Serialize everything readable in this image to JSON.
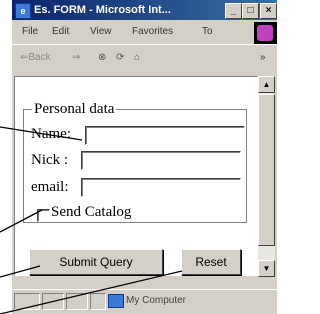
{
  "window": {
    "title": "Es. FORM - Microsoft Int...",
    "minimize": "_",
    "maximize": "□",
    "close": "×",
    "app_icon": "ie-icon"
  },
  "menu": [
    "File",
    "Edit",
    "View",
    "Favorites",
    "To"
  ],
  "toolbar": {
    "back": "⇐Back",
    "forward": "⇒",
    "stop": "⊗",
    "refresh": "⟳",
    "home": "⌂",
    "chevron": "»"
  },
  "form": {
    "legend": "Personal data",
    "name_label": "Name:",
    "nick_label": "Nick :",
    "email_label": "email:",
    "name_value": "",
    "nick_value": "",
    "email_value": "",
    "checkbox_label": "Send Catalog",
    "checkbox_checked": false,
    "submit_label": "Submit Query",
    "reset_label": "Reset"
  },
  "scroll": {
    "up": "▲",
    "down": "▼"
  },
  "status": {
    "zone": "My Computer"
  },
  "colors": {
    "window_bg": "#d4d0c8",
    "title_bar": "#0a246a",
    "brand_logo": "#c040c0"
  }
}
